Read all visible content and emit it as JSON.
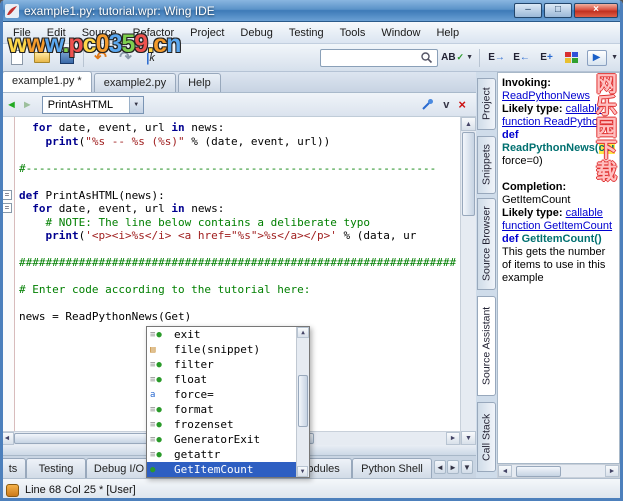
{
  "window": {
    "title": "example1.py: tutorial.wpr: Wing IDE"
  },
  "icons": {
    "minimize": "–",
    "maximize": "□",
    "close": "×",
    "back": "◄",
    "forward": "►",
    "chevron": "v",
    "editor_close": "×",
    "spellcheck": "AB",
    "check": "✓"
  },
  "menu": {
    "items": [
      "File",
      "Edit",
      "Source",
      "Refactor",
      "Project",
      "Debug",
      "Testing",
      "Tools",
      "Window",
      "Help"
    ]
  },
  "search": {
    "value": ""
  },
  "editor_tabs": [
    {
      "label": "example1.py *",
      "active": true
    },
    {
      "label": "example2.py",
      "active": false
    },
    {
      "label": "Help",
      "active": false
    }
  ],
  "nav": {
    "symbol": "PrintAsHTML"
  },
  "code": {
    "fold_lines": [
      5,
      6
    ],
    "lines": [
      {
        "segs": [
          {
            "t": "  ",
            "c": ""
          },
          {
            "t": "for",
            "c": "k"
          },
          {
            "t": " date, event, url ",
            "c": ""
          },
          {
            "t": "in",
            "c": "k"
          },
          {
            "t": " news:",
            "c": ""
          }
        ]
      },
      {
        "segs": [
          {
            "t": "    ",
            "c": ""
          },
          {
            "t": "print",
            "c": "k"
          },
          {
            "t": "(",
            "c": ""
          },
          {
            "t": "\"%s -- %s (%s)\"",
            "c": "s"
          },
          {
            "t": " % (date, event, url))",
            "c": ""
          }
        ]
      },
      {
        "segs": []
      },
      {
        "segs": [
          {
            "t": "#--------------------------------------------------------------",
            "c": "c"
          }
        ]
      },
      {
        "segs": []
      },
      {
        "segs": [
          {
            "t": "def",
            "c": "k"
          },
          {
            "t": " PrintAsHTML(news):",
            "c": ""
          }
        ]
      },
      {
        "segs": [
          {
            "t": "  ",
            "c": ""
          },
          {
            "t": "for",
            "c": "k"
          },
          {
            "t": " date, event, url ",
            "c": ""
          },
          {
            "t": "in",
            "c": "k"
          },
          {
            "t": " news:",
            "c": ""
          }
        ]
      },
      {
        "segs": [
          {
            "t": "    ",
            "c": ""
          },
          {
            "t": "# NOTE: The line below contains a deliberate typo",
            "c": "c"
          }
        ]
      },
      {
        "segs": [
          {
            "t": "    ",
            "c": ""
          },
          {
            "t": "print",
            "c": "k"
          },
          {
            "t": "(",
            "c": ""
          },
          {
            "t": "'<p><i>%s</i> <a href=\"%s\">%s</a></p>'",
            "c": "s"
          },
          {
            "t": " % (data, ur",
            "c": ""
          }
        ]
      },
      {
        "segs": []
      },
      {
        "segs": [
          {
            "t": "##################################################################",
            "c": "c"
          }
        ]
      },
      {
        "segs": []
      },
      {
        "segs": [
          {
            "t": "# Enter code according to the tutorial here:",
            "c": "c"
          }
        ]
      },
      {
        "segs": []
      },
      {
        "segs": [
          {
            "t": "news = ReadPythonNews(Get)",
            "c": ""
          }
        ]
      }
    ]
  },
  "completion": {
    "selected_index": 9,
    "items": [
      {
        "label": "exit",
        "icon": "builtin"
      },
      {
        "label": "file(snippet)",
        "icon": "snippet"
      },
      {
        "label": "filter",
        "icon": "builtin"
      },
      {
        "label": "float",
        "icon": "builtin"
      },
      {
        "label": "force=",
        "icon": "argument"
      },
      {
        "label": "format",
        "icon": "builtin"
      },
      {
        "label": "frozenset",
        "icon": "builtin"
      },
      {
        "label": "GeneratorExit",
        "icon": "builtin"
      },
      {
        "label": "getattr",
        "icon": "builtin"
      },
      {
        "label": "GetItemCount",
        "icon": "function"
      }
    ]
  },
  "assistant": {
    "lines": [
      {
        "segs": [
          {
            "t": "Invoking:",
            "c": "b"
          }
        ]
      },
      {
        "segs": [
          {
            "t": "ReadPythonNews",
            "c": "link"
          }
        ]
      },
      {
        "c": "nw",
        "segs": [
          {
            "t": "Likely type:",
            "c": "b"
          },
          {
            "t": " ",
            "c": ""
          },
          {
            "t": "callable",
            "c": "link"
          }
        ]
      },
      {
        "c": "nw",
        "segs": [
          {
            "t": "function ReadPythonNews",
            "c": "link"
          }
        ]
      },
      {
        "segs": [
          {
            "t": "def",
            "c": "kw"
          }
        ]
      },
      {
        "c": "nw",
        "segs": [
          {
            "t": "ReadPythonNews(",
            "c": "fn"
          },
          {
            "t": "count",
            "c": "fn hl"
          }
        ]
      },
      {
        "segs": [
          {
            "t": "force=0)",
            "c": ""
          }
        ]
      },
      {
        "segs": []
      },
      {
        "segs": [
          {
            "t": "Completion:",
            "c": "b"
          }
        ]
      },
      {
        "segs": [
          {
            "t": "GetItemCount",
            "c": ""
          }
        ]
      },
      {
        "c": "nw",
        "segs": [
          {
            "t": "Likely type:",
            "c": "b"
          },
          {
            "t": " ",
            "c": ""
          },
          {
            "t": "callable",
            "c": "link"
          }
        ]
      },
      {
        "c": "nw",
        "segs": [
          {
            "t": "function GetItemCount",
            "c": "link"
          }
        ]
      },
      {
        "c": "nw",
        "segs": [
          {
            "t": "def ",
            "c": "kw"
          },
          {
            "t": "GetItemCount()",
            "c": "fn"
          }
        ]
      },
      {
        "segs": [
          {
            "t": "This gets the number of items to use in this example",
            "c": ""
          }
        ]
      }
    ]
  },
  "right_tabs": [
    "Project",
    "Snippets",
    "Source Browser",
    "Source Assistant",
    "Call Stack"
  ],
  "bottom_tabs": [
    "ts",
    "Testing",
    "Debug I/O",
    "Modules",
    "Python Shell"
  ],
  "status": {
    "text": "Line 68 Col 25 * [User]"
  },
  "watermark": {
    "site": "www.pc0359.cn",
    "vertical": "网乐园下载",
    "site_colors": [
      "#ffd84a",
      "#f59b2c",
      "#5aa7ef",
      "#7ed04e",
      "#ef5350"
    ]
  }
}
